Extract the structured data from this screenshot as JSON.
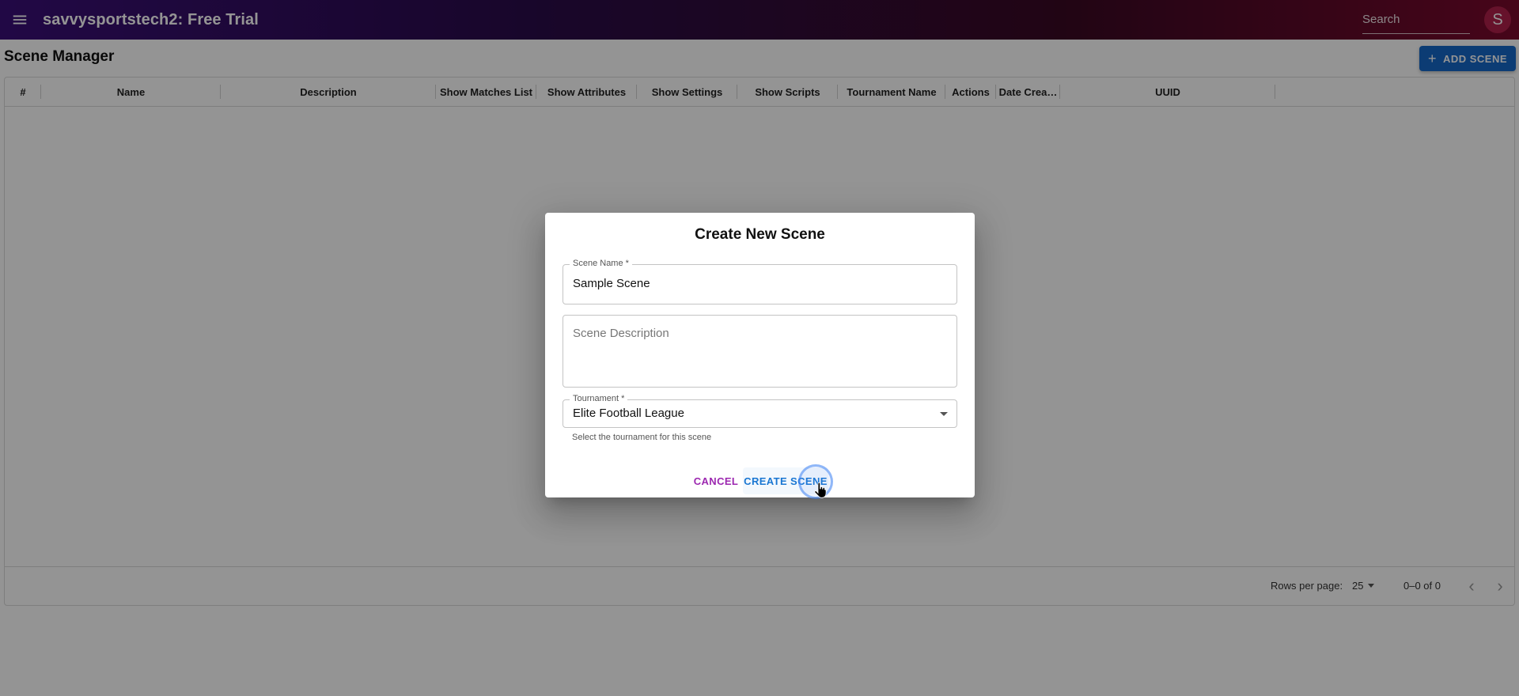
{
  "app": {
    "title": "savvysportstech2: Free Trial",
    "search_placeholder": "Search",
    "avatar_letter": "S",
    "menu_icon": "menu-icon"
  },
  "page": {
    "title": "Scene Manager",
    "add_button_label": "ADD SCENE",
    "add_button_icon": "plus-icon"
  },
  "table": {
    "columns": [
      "#",
      "Name",
      "Description",
      "Show Matches List",
      "Show Attributes",
      "Show Settings",
      "Show Scripts",
      "Tournament Name",
      "Actions",
      "Date Crea…",
      "UUID"
    ],
    "rows": []
  },
  "pagination": {
    "rows_per_page_label": "Rows per page:",
    "rows_per_page": "25",
    "page_info": "0–0 of 0"
  },
  "dialog": {
    "title": "Create New Scene",
    "scene_name_label": "Scene Name *",
    "scene_name_value": "Sample Scene",
    "description_placeholder": "Scene Description",
    "tournament_label": "Tournament *",
    "tournament_value": "Elite Football League",
    "tournament_helper": "Select the tournament for this scene",
    "cancel_label": "CANCEL",
    "create_label": "CREATE SCENE"
  },
  "colors": {
    "primary": "#1668c8",
    "secondary": "#9c27b0",
    "appbar_start": "#3a0f78",
    "appbar_end": "#7a0a2c",
    "avatar": "#b0204a"
  }
}
